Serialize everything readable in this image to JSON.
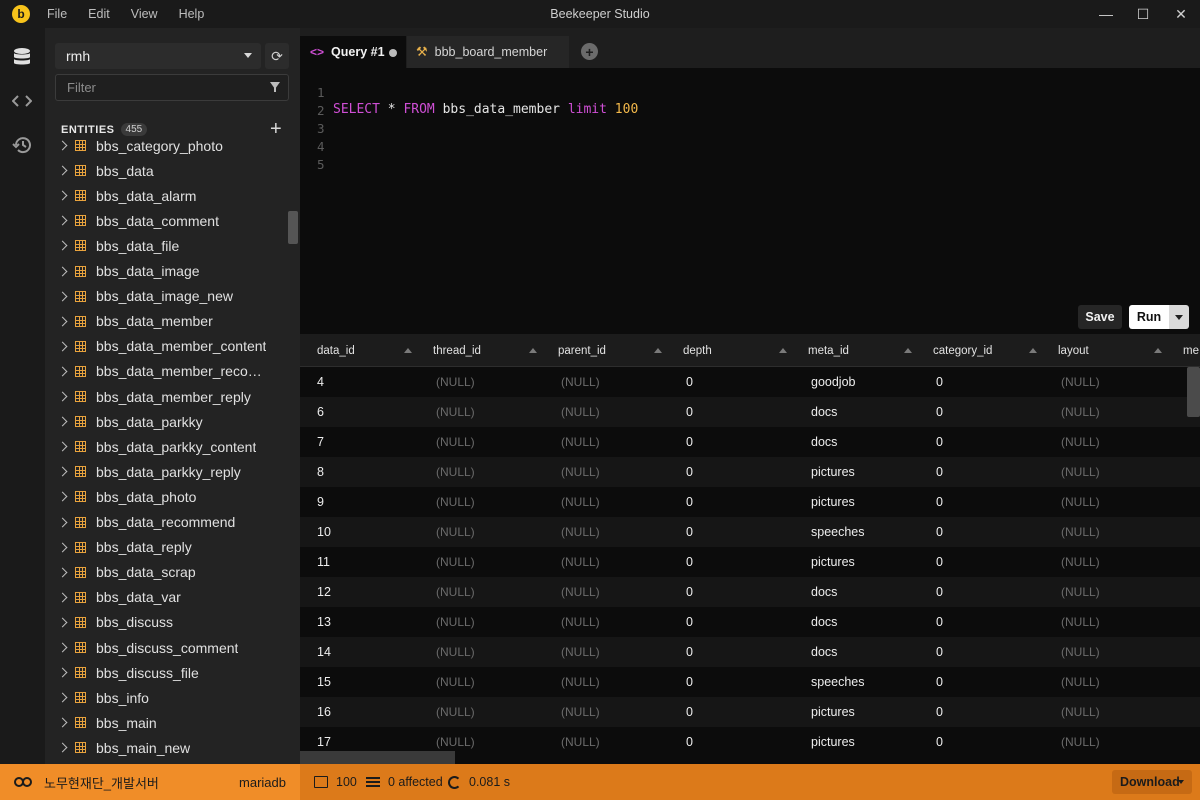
{
  "window": {
    "title": "Beekeeper Studio",
    "menu": [
      "File",
      "Edit",
      "View",
      "Help"
    ]
  },
  "sidebar": {
    "connection": "rmh",
    "filter_placeholder": "Filter",
    "entities_label": "ENTITIES",
    "entities_count": "455",
    "entities": [
      "bbs_category_photo",
      "bbs_data",
      "bbs_data_alarm",
      "bbs_data_comment",
      "bbs_data_file",
      "bbs_data_image",
      "bbs_data_image_new",
      "bbs_data_member",
      "bbs_data_member_content",
      "bbs_data_member_recom...",
      "bbs_data_member_reply",
      "bbs_data_parkky",
      "bbs_data_parkky_content",
      "bbs_data_parkky_reply",
      "bbs_data_photo",
      "bbs_data_recommend",
      "bbs_data_reply",
      "bbs_data_scrap",
      "bbs_data_var",
      "bbs_discuss",
      "bbs_discuss_comment",
      "bbs_discuss_file",
      "bbs_info",
      "bbs_main",
      "bbs_main_new"
    ]
  },
  "tabs": {
    "active_tab": {
      "icon": "<>",
      "label": "Query #1"
    },
    "second_tab": {
      "label": "bbb_board_member"
    }
  },
  "editor": {
    "line_numbers": [
      "1",
      "2",
      "3",
      "4",
      "5"
    ],
    "query": {
      "kw1": "SELECT",
      "star": " * ",
      "kw2": "FROM",
      "table": " bbs_data_member ",
      "kw3": "limit",
      "space": " ",
      "limit": "100"
    },
    "save_label": "Save",
    "run_label": "Run"
  },
  "results": {
    "columns": [
      "data_id",
      "thread_id",
      "parent_id",
      "depth",
      "meta_id",
      "category_id",
      "layout",
      "me"
    ],
    "rows": [
      [
        "4",
        "(NULL)",
        "(NULL)",
        "0",
        "goodjob",
        "0",
        "(NULL)"
      ],
      [
        "6",
        "(NULL)",
        "(NULL)",
        "0",
        "docs",
        "0",
        "(NULL)"
      ],
      [
        "7",
        "(NULL)",
        "(NULL)",
        "0",
        "docs",
        "0",
        "(NULL)"
      ],
      [
        "8",
        "(NULL)",
        "(NULL)",
        "0",
        "pictures",
        "0",
        "(NULL)"
      ],
      [
        "9",
        "(NULL)",
        "(NULL)",
        "0",
        "pictures",
        "0",
        "(NULL)"
      ],
      [
        "10",
        "(NULL)",
        "(NULL)",
        "0",
        "speeches",
        "0",
        "(NULL)"
      ],
      [
        "11",
        "(NULL)",
        "(NULL)",
        "0",
        "pictures",
        "0",
        "(NULL)"
      ],
      [
        "12",
        "(NULL)",
        "(NULL)",
        "0",
        "docs",
        "0",
        "(NULL)"
      ],
      [
        "13",
        "(NULL)",
        "(NULL)",
        "0",
        "docs",
        "0",
        "(NULL)"
      ],
      [
        "14",
        "(NULL)",
        "(NULL)",
        "0",
        "docs",
        "0",
        "(NULL)"
      ],
      [
        "15",
        "(NULL)",
        "(NULL)",
        "0",
        "speeches",
        "0",
        "(NULL)"
      ],
      [
        "16",
        "(NULL)",
        "(NULL)",
        "0",
        "pictures",
        "0",
        "(NULL)"
      ],
      [
        "17",
        "(NULL)",
        "(NULL)",
        "0",
        "pictures",
        "0",
        "(NULL)"
      ]
    ]
  },
  "statusbar": {
    "connection_name": "노무현재단_개발서버",
    "connection_type": "mariadb",
    "row_count": "100",
    "affected": "0 affected",
    "duration": "0.081 s",
    "download_label": "Download"
  },
  "colors": {
    "accent": "#f08d28",
    "statusbar": "#dc7a1a",
    "keyword": "#d04fd6",
    "number": "#f3b84a",
    "table_icon": "#e9a33d"
  }
}
